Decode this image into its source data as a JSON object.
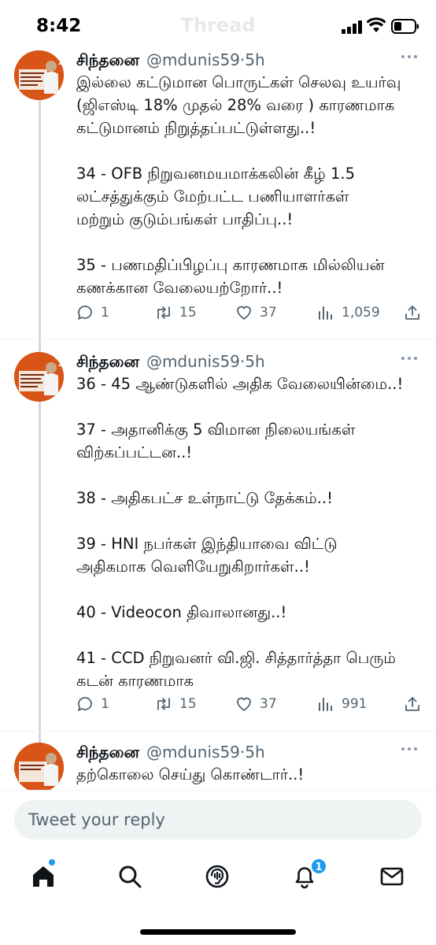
{
  "status_bar": {
    "time": "8:42"
  },
  "nav": {
    "title": "Thread"
  },
  "tweets": [
    {
      "author": "சிந்தனை",
      "handle": "@mdunis59",
      "time": "5h",
      "lines": [
        "இல்லை கட்டுமான பொருட்கள் செலவு உயர்வு",
        "(ஜிஎஸ்டி 18% முதல் 28% வரை ) காரணமாக",
        "கட்டுமானம் நிறுத்தப்பட்டுள்ளது..!",
        "",
        "34 - OFB நிறுவனமயமாக்கலின் கீழ் 1.5",
        "லட்சத்துக்கும் மேற்பட்ட பணியாளர்கள்",
        "மற்றும் குடும்பங்கள் பாதிப்பு..!",
        "",
        "35 - பணமதிப்பிழப்பு காரணமாக மில்லியன்",
        "கணக்கான வேலையற்றோர்..!"
      ],
      "replies": "1",
      "retweets": "15",
      "likes": "37",
      "views": "1,059"
    },
    {
      "author": "சிந்தனை",
      "handle": "@mdunis59",
      "time": "5h",
      "lines": [
        "36 - 45 ஆண்டுகளில் அதிக வேலையின்மை..!",
        "",
        "37 - அதானிக்கு 5 விமான நிலையங்கள்",
        "விற்கப்பட்டன..!",
        "",
        "38 - அதிகபட்ச உள்நாட்டு தேக்கம்..!",
        "",
        "39 - HNI நபர்கள் இந்தியாவை விட்டு",
        "அதிகமாக வெளியேறுகிறார்கள்..!",
        "",
        "40 - Videocon திவாலானது..!",
        "",
        "41 - CCD நிறுவனர் வி.ஜி. சித்தார்த்தா பெரும்",
        "கடன் காரணமாக"
      ],
      "replies": "1",
      "retweets": "15",
      "likes": "37",
      "views": "991"
    },
    {
      "author": "சிந்தனை",
      "handle": "@mdunis59",
      "time": "5h",
      "lines": [
        "தற்கொலை செய்து கொண்டார்..!"
      ]
    }
  ],
  "reply": {
    "placeholder": "Tweet your reply"
  },
  "tabbar": {
    "tabs": [
      {
        "name": "home",
        "icon": "home-icon",
        "has_dot": true
      },
      {
        "name": "search",
        "icon": "search-icon"
      },
      {
        "name": "spaces",
        "icon": "spaces-icon"
      },
      {
        "name": "notifications",
        "icon": "bell-icon",
        "badge": "1"
      },
      {
        "name": "messages",
        "icon": "envelope-icon"
      }
    ]
  },
  "colors": {
    "text": "#0f1419",
    "secondary": "#536471",
    "accent": "#1d9bf0",
    "thread_line": "#cfd9de",
    "input_bg": "#eff3f4"
  }
}
